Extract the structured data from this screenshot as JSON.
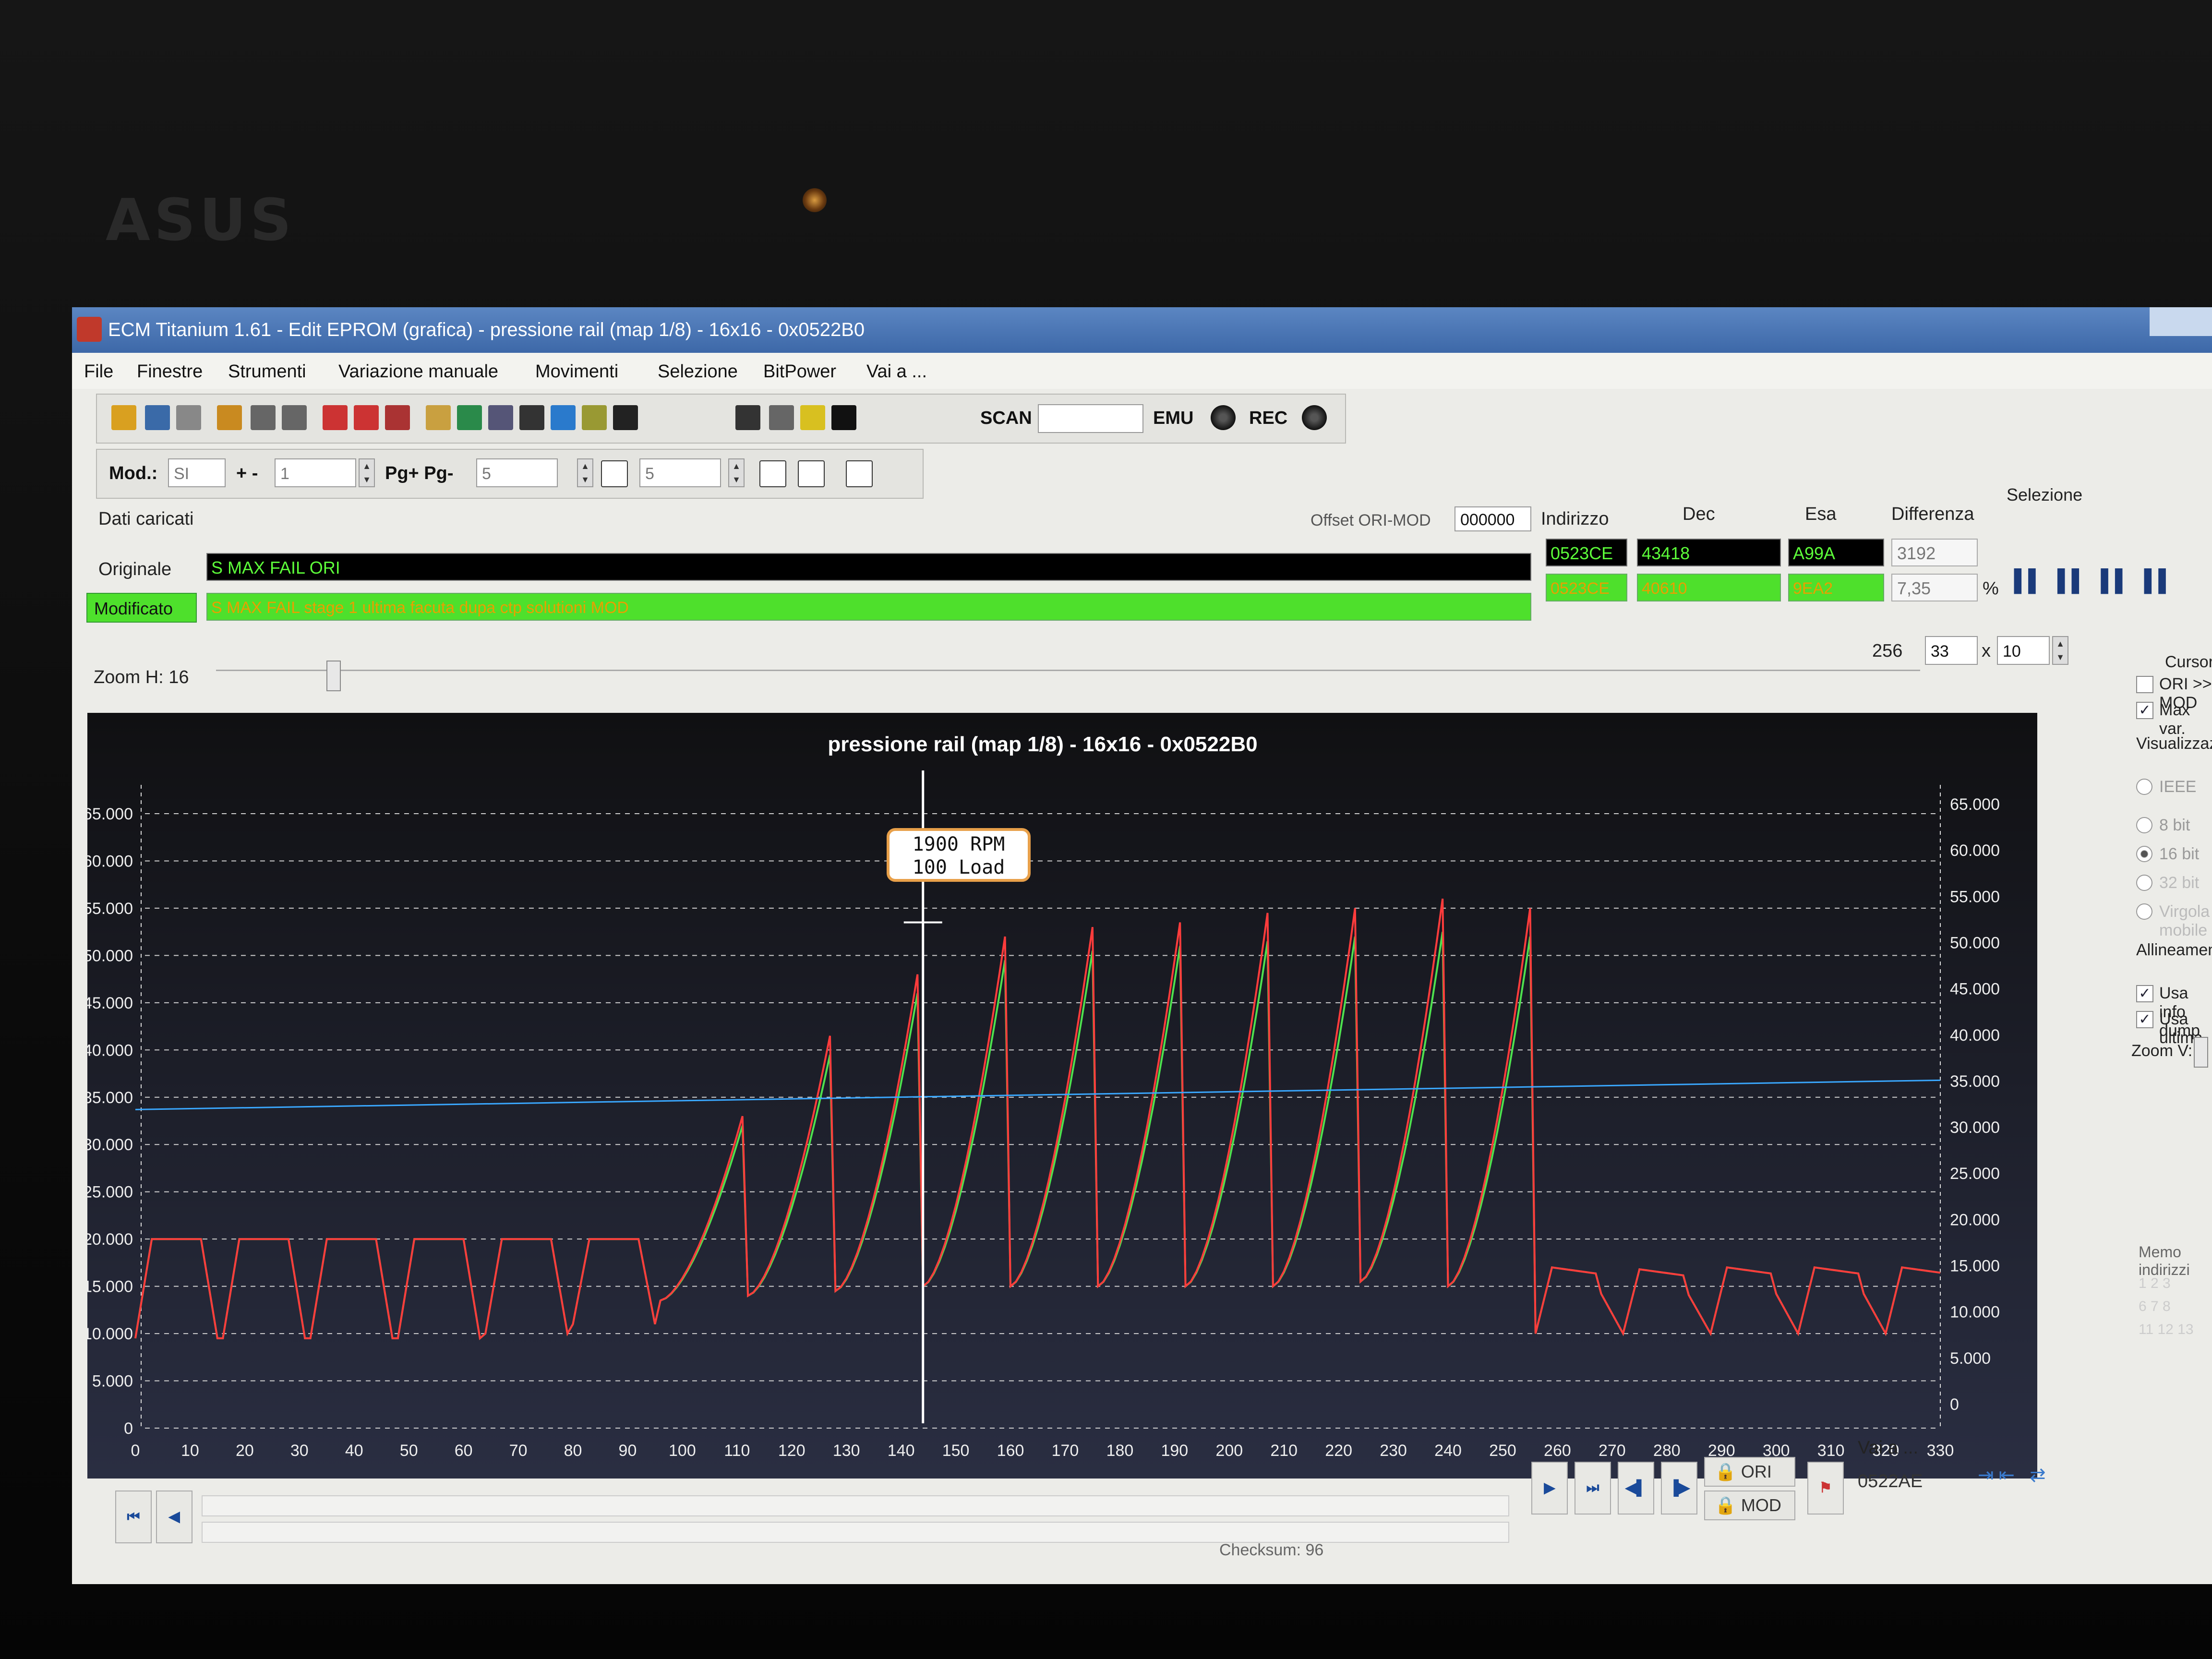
{
  "laptop": {
    "brand": "ASUS"
  },
  "window": {
    "title": "ECM Titanium 1.61 - Edit EPROM (grafica) - pressione rail (map 1/8) - 16x16 - 0x0522B0"
  },
  "menu": [
    "File",
    "Finestre",
    "Strumenti",
    "Variazione manuale",
    "Movimenti",
    "Selezione",
    "BitPower",
    "Vai a ..."
  ],
  "toolbar1": {
    "icons": [
      "home-icon",
      "windows-icon",
      "copy-icon",
      "open-folder-icon",
      "block-icon",
      "block2-icon",
      "check-map-icon",
      "map-red-icon",
      "map-calc-icon",
      "puzzle-icon",
      "book-icon",
      "edit-icon",
      "sigma-icon",
      "color-map-icon",
      "grid-icon",
      "binoculars-icon",
      "window-icon",
      "lock-icon",
      "runner-icon",
      "record-icon"
    ],
    "scan_label": "SCAN",
    "scan_value": "",
    "emu_label": "EMU",
    "rec_label": "REC"
  },
  "toolbar2": {
    "mod_label": "Mod.:",
    "mod_value": "SI",
    "plusminus_label": "+ -",
    "plusminus_value": "1",
    "page_label": "Pg+ Pg-",
    "page_value": "5",
    "field3_value": "5"
  },
  "data_panel": {
    "heading": "Dati caricati",
    "offset_label": "Offset ORI-MOD",
    "offset_value": "000000",
    "columns": [
      "Indirizzo",
      "Dec",
      "Esa",
      "Differenza"
    ],
    "original_label": "Originale",
    "original_name": "S MAX FAIL ORI",
    "original_address": "0523CE",
    "original_dec": "43418",
    "original_hex": "A99A",
    "difference": "3192",
    "modified_label": "Modificato",
    "modified_name": "S MAX FAIL stage 1 ultima facuta dupa ctp solutioni MOD",
    "modified_address": "0523CE",
    "modified_dec": "40610",
    "modified_hex": "9EA2",
    "difference_pct": "7,35",
    "pct_sign": "%",
    "selection_label": "Selezione"
  },
  "zoom_row": {
    "zoom_h_label": "Zoom H: 16",
    "count": "256",
    "dim_a": "33",
    "x_sign": "x",
    "dim_b": "10"
  },
  "sidepanel": {
    "cursor_label": "Cursore",
    "ori_mod_label": "ORI >> MOD",
    "max_var_label": "Max var.",
    "view_label": "Visualizzazione",
    "ieee_label": "IEEE",
    "bit8": "8 bit",
    "bit16": "16 bit",
    "bit32": "32 bit",
    "virgola": "Virgola mobile",
    "alignment_label": "Allineamento:",
    "use_info": "Usa info dump",
    "use_last": "Usa ultima",
    "zoom_v": "Zoom V:",
    "memo": "Memo indirizzi"
  },
  "bottom": {
    "ori_btn": "ORI",
    "mod_btn": "MOD",
    "goto_label": "Vai a ...",
    "goto_value": "0522AE",
    "checksum": "Checksum: 96"
  },
  "tooltip": {
    "line1": "1900 RPM",
    "line2": "100 Load"
  },
  "colors": {
    "original": "#ff3c3c",
    "modified": "#4ee04e",
    "reference": "#3aa8ff",
    "cursor": "#ffffff"
  },
  "chart_data": {
    "type": "line",
    "title": "pressione rail (map 1/8) - 16x16 - 0x0522B0",
    "xlim": [
      0,
      330
    ],
    "ylim_left": [
      0,
      65000
    ],
    "ylim_right": [
      0,
      65000
    ],
    "x_ticks": [
      0,
      10,
      20,
      30,
      40,
      50,
      60,
      70,
      80,
      90,
      100,
      110,
      120,
      130,
      140,
      150,
      160,
      170,
      180,
      190,
      200,
      210,
      220,
      230,
      240,
      250,
      260,
      270,
      280,
      290,
      300,
      310,
      320,
      330
    ],
    "y_ticks_left": [
      "0",
      "5.000",
      "10.000",
      "15.000",
      "20.000",
      "25.000",
      "30.000",
      "35.000",
      "40.000",
      "45.000",
      "50.000",
      "55.000",
      "60.000",
      "65.000"
    ],
    "y_ticks_right": [
      "0",
      "5.000",
      "10.000",
      "15.000",
      "20.000",
      "25.000",
      "30.000",
      "35.000",
      "40.000",
      "45.000",
      "50.000",
      "55.000",
      "60.000",
      "65.000"
    ],
    "grid": true,
    "cursor_x": 144,
    "row_peaks_original": [
      20000,
      20000,
      20000,
      20000,
      20000,
      20000,
      33000,
      41500,
      48000,
      52000,
      53000,
      53500,
      54500,
      55000,
      56000,
      55000
    ],
    "row_peaks_modified": [
      20000,
      20000,
      20000,
      20000,
      20000,
      20000,
      32000,
      39500,
      46000,
      49500,
      50500,
      51000,
      51500,
      52000,
      52500,
      52000
    ],
    "row_starts": [
      9500,
      9500,
      9500,
      9500,
      10000,
      11000,
      13500,
      14000,
      14500,
      15000,
      15000,
      15000,
      15000,
      15000,
      15500,
      15000
    ],
    "tail_peaks": [
      17000,
      16800,
      17000,
      17000,
      17000
    ],
    "tail_start": 10000,
    "reference_line": {
      "start": 33700,
      "end": 36800
    }
  }
}
